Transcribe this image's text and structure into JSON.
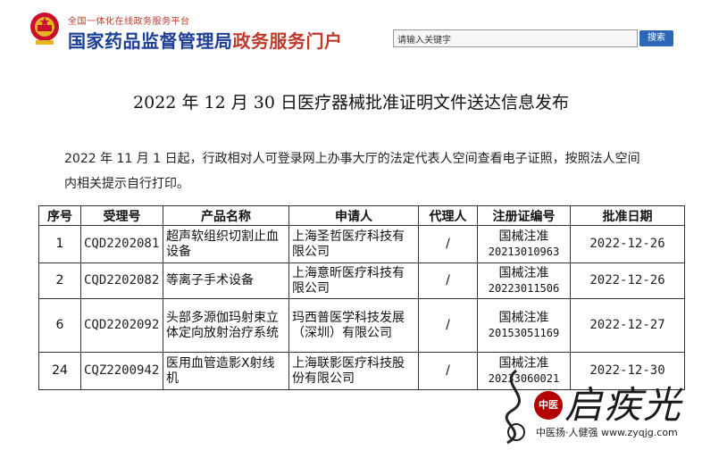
{
  "header": {
    "portal_small": "全国一体化在线政务服务平台",
    "portal_title_main": "国家药品监督管理局",
    "portal_title_red": "政务服务门户",
    "search_placeholder": "请输入关键字",
    "search_button": "搜索",
    "colors": {
      "brand_blue": "#1c3f95",
      "brand_red": "#c0392b",
      "button_blue": "#2d67b7"
    }
  },
  "page": {
    "title": "2022 年 12 月 30 日医疗器械批准证明文件送达信息发布",
    "intro": "2022 年 11 月 1 日起，行政相对人可登录网上办事大厅的法定代表人空间查看电子证照，按照法人空间内相关提示自行打印。"
  },
  "table": {
    "headers": [
      "序号",
      "受理号",
      "产品名称",
      "申请人",
      "代理人",
      "注册证编号",
      "批准日期"
    ],
    "rows": [
      {
        "seq": "1",
        "acceptance_no": "CQD2202081",
        "product": "超声软组织切割止血设备",
        "applicant": "上海圣哲医疗科技有限公司",
        "agent": "/",
        "reg_prefix": "国械注准",
        "reg_no": "20213010963",
        "date": "2022-12-26"
      },
      {
        "seq": "2",
        "acceptance_no": "CQD2202082",
        "product": "等离子手术设备",
        "applicant": "上海意昕医疗科技有限公司",
        "agent": "/",
        "reg_prefix": "国械注准",
        "reg_no": "20223011506",
        "date": "2022-12-26"
      },
      {
        "seq": "6",
        "acceptance_no": "CQD2202092",
        "product": "头部多源伽玛射束立体定向放射治疗系统",
        "applicant": "玛西普医学科技发展（深圳）有限公司",
        "agent": "/",
        "reg_prefix": "国械注准",
        "reg_no": "20153051169",
        "date": "2022-12-27"
      },
      {
        "seq": "24",
        "acceptance_no": "CQZ2200942",
        "product": "医用血管造影X射线机",
        "applicant": "上海联影医疗科技股份有限公司",
        "agent": "/",
        "reg_prefix": "国械注准",
        "reg_no": "20233060021",
        "date": "2022-12-30"
      }
    ]
  },
  "watermark": {
    "badge": "中医",
    "brand": "启疾光",
    "sub": "中医扬·人健强 www.zyqjg.com"
  }
}
